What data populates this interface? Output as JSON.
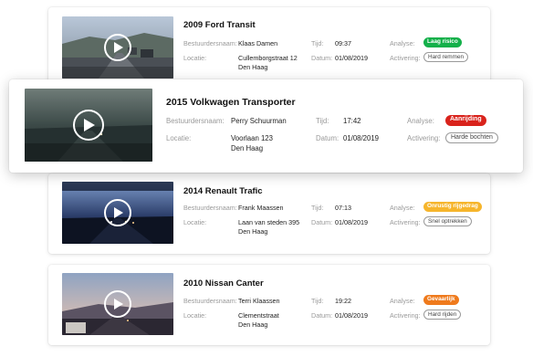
{
  "labels": {
    "driver": "Bestuurdersnaam:",
    "location": "Locatie:",
    "time": "Tijd:",
    "date": "Datum:",
    "analysis": "Analyse:",
    "activation": "Activering:"
  },
  "colors": {
    "green": "#14b04a",
    "red": "#d9231c",
    "yellow": "#f6b52c",
    "orange": "#ef7a1c"
  },
  "icon": "play-icon",
  "cards": [
    {
      "vehicle": "2009 Ford Transit",
      "driver": "Klaas Damen",
      "location_line1": "Cullemborgstraat 12",
      "location_line2": "Den Haag",
      "time": "09:37",
      "date": "01/08/2019",
      "analysis": "Laag risico",
      "analysis_color": "green",
      "activation": "Hard remmen"
    },
    {
      "vehicle": "2015 Volkwagen Transporter",
      "driver": "Perry Schuurman",
      "location_line1": "Voorlaan 123",
      "location_line2": "Den Haag",
      "time": "17:42",
      "date": "01/08/2019",
      "analysis": "Aanrijding",
      "analysis_color": "red",
      "activation": "Harde bochten"
    },
    {
      "vehicle": "2014 Renault Trafic",
      "driver": "Frank Maassen",
      "location_line1": "Laan van steden 395",
      "location_line2": "Den Haag",
      "time": "07:13",
      "date": "01/08/2019",
      "analysis": "Onrustig rijgedrag",
      "analysis_color": "yellow",
      "activation": "Snel optrekken"
    },
    {
      "vehicle": "2010 Nissan Canter",
      "driver": "Terri Klaassen",
      "location_line1": "Clementstraat",
      "location_line2": "Den Haag",
      "time": "19:22",
      "date": "01/08/2019",
      "analysis": "Gevaarlijk",
      "analysis_color": "orange",
      "activation": "Hard rijden"
    }
  ]
}
